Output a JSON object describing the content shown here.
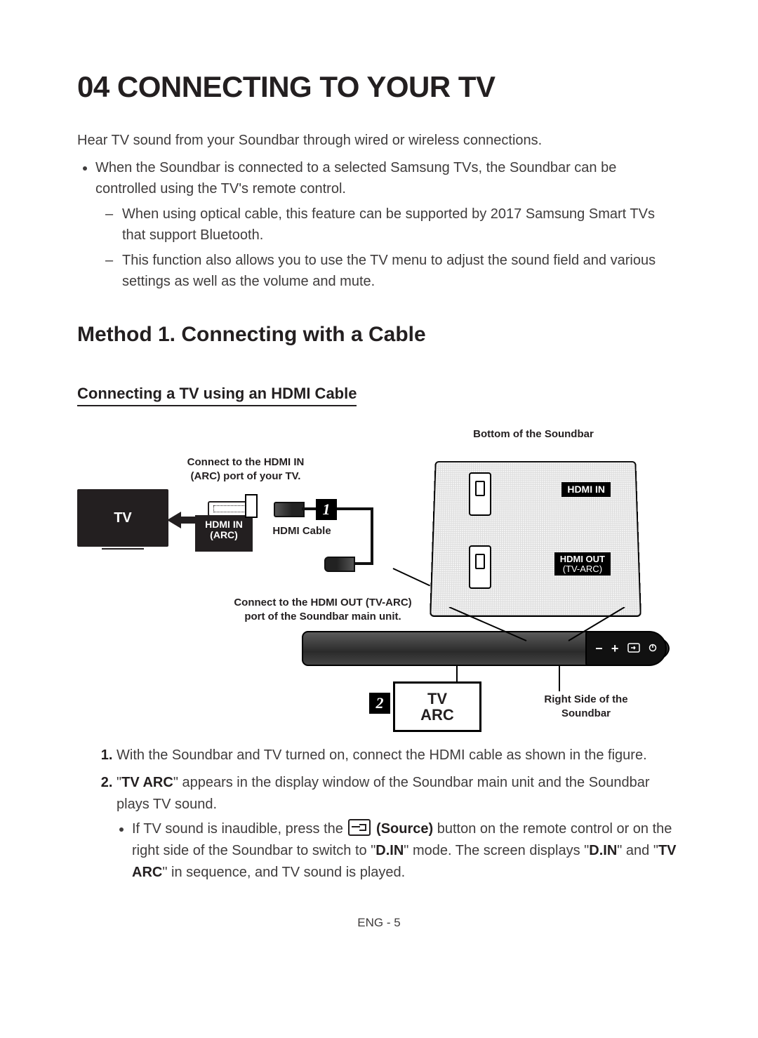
{
  "title": "04  CONNECTING TO YOUR TV",
  "intro": "Hear TV sound from your Soundbar through wired or wireless connections.",
  "bullet1": "When the Soundbar is connected to a selected Samsung TVs, the Soundbar can be controlled using the TV's remote control.",
  "sub1": "When using optical cable, this feature can be supported by 2017 Samsung Smart TVs that support Bluetooth.",
  "sub2": "This function also allows you to use the TV menu to adjust the sound field and various settings as well as the volume and mute.",
  "h2": "Method 1. Connecting with a Cable",
  "h3": "Connecting a TV using an HDMI Cable",
  "diagram": {
    "top_right_label": "Bottom of the Soundbar",
    "connect_tv_label": "Connect to the HDMI IN (ARC) port of your TV.",
    "tv_label": "TV",
    "hdmi_in_arc": "HDMI IN\n(ARC)",
    "cable_label": "HDMI Cable",
    "connect_soundbar_label": "Connect to the HDMI OUT (TV-ARC) port of the Soundbar main unit.",
    "port_in": "HDMI IN",
    "port_out_l1": "HDMI OUT",
    "port_out_l2": "(TV-ARC)",
    "right_side_label": "Right Side of the Soundbar",
    "display_l1": "TV",
    "display_l2": "ARC",
    "badge1": "1",
    "badge2": "2",
    "sb_minus": "−",
    "sb_plus": "+"
  },
  "steps": {
    "s1": "With the Soundbar and TV turned on, connect the HDMI cable as shown in the figure.",
    "s2_pre": "\"",
    "s2_tvarc": "TV ARC",
    "s2_post": "\" appears in the display window of the Soundbar main unit and the Soundbar plays TV sound.",
    "s2_sub_pre": "If TV sound is inaudible, press the ",
    "s2_source": " (Source)",
    "s2_sub_mid1": " button on the remote control or on the right side of the Soundbar to switch to \"",
    "s2_din": "D.IN",
    "s2_sub_mid2": "\" mode. The screen displays \"",
    "s2_sub_mid3": "\" and \"",
    "s2_sub_end": "\" in sequence, and TV sound is played."
  },
  "footer": "ENG - 5"
}
